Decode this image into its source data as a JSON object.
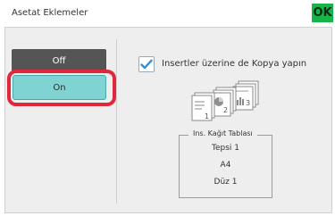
{
  "header": {
    "title": "Asetat Eklemeler",
    "ok_label": "OK"
  },
  "toggle": {
    "off_label": "Off",
    "on_label": "On",
    "selected": "On"
  },
  "option": {
    "checkbox_label": "Insertler üzerine de Kopya yapın",
    "checked": true
  },
  "illustration": {
    "page_numbers": [
      "1",
      "2",
      "3"
    ]
  },
  "tray": {
    "legend": "Ins. Kağıt Tablası",
    "lines": [
      "Tepsi 1",
      "A4",
      "Düz 1"
    ]
  },
  "colors": {
    "ok": "#15b54a",
    "on_button": "#80d3d3",
    "off_button": "#555555",
    "highlight": "#e0283c",
    "checkbox_check": "#2e8fe0"
  }
}
